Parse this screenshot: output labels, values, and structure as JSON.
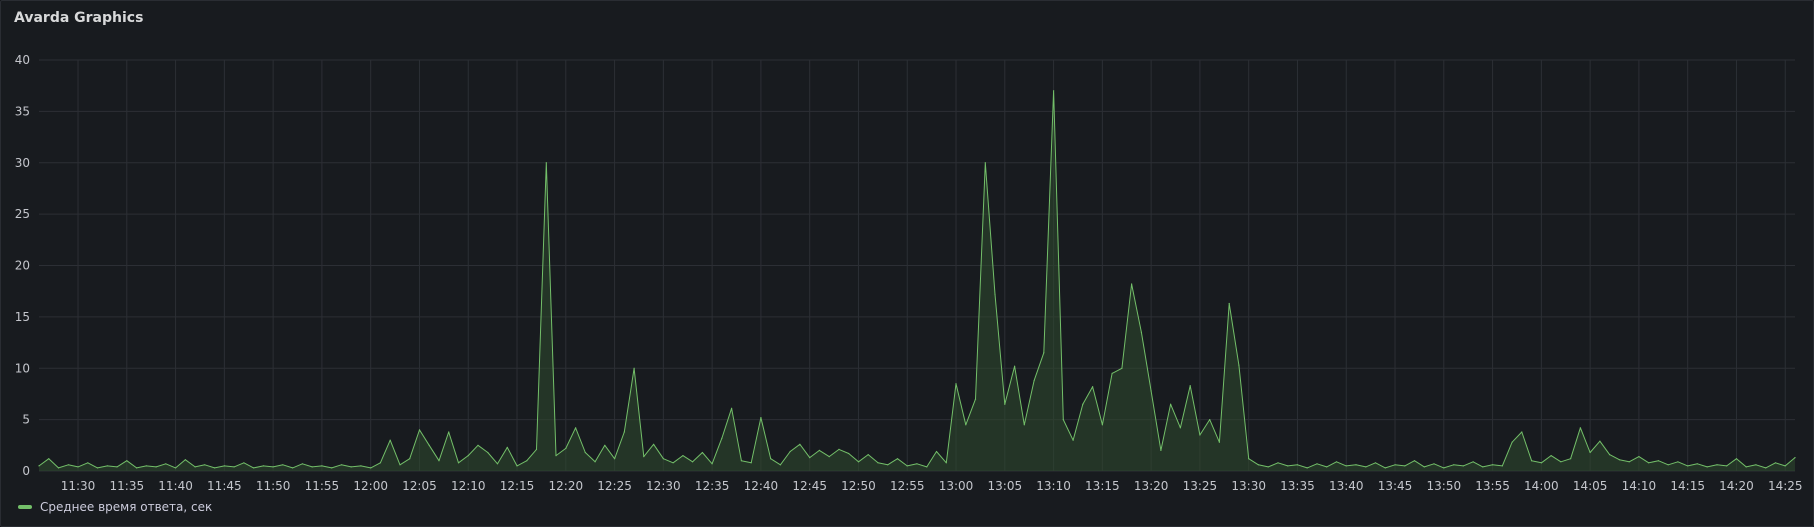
{
  "panel": {
    "title": "Avarda Graphics"
  },
  "colors": {
    "series": "#73bf69",
    "series_fill": "#2f4a2d",
    "grid": "#2c2f35",
    "background": "#181b1f"
  },
  "chart_data": {
    "type": "line",
    "title": "Avarda Graphics",
    "xlabel": "",
    "ylabel": "",
    "ylim": [
      0,
      40
    ],
    "y_ticks": [
      0,
      5,
      10,
      15,
      20,
      25,
      30,
      35,
      40
    ],
    "x_range": [
      "11:26",
      "14:26"
    ],
    "x_ticks": [
      "11:30",
      "11:35",
      "11:40",
      "11:45",
      "11:50",
      "11:55",
      "12:00",
      "12:05",
      "12:10",
      "12:15",
      "12:20",
      "12:25",
      "12:30",
      "12:35",
      "12:40",
      "12:45",
      "12:50",
      "12:55",
      "13:00",
      "13:05",
      "13:10",
      "13:15",
      "13:20",
      "13:25",
      "13:30",
      "13:35",
      "13:40",
      "13:45",
      "13:50",
      "13:55",
      "14:00",
      "14:05",
      "14:10",
      "14:15",
      "14:20",
      "14:25"
    ],
    "grid": true,
    "legend_placement": "bottom-left",
    "series": [
      {
        "name": "Среднее время ответа, сек",
        "color": "#73bf69",
        "points": [
          [
            "11:26",
            0.5
          ],
          [
            "11:27",
            1.2
          ],
          [
            "11:28",
            0.3
          ],
          [
            "11:29",
            0.6
          ],
          [
            "11:30",
            0.4
          ],
          [
            "11:31",
            0.8
          ],
          [
            "11:32",
            0.3
          ],
          [
            "11:33",
            0.5
          ],
          [
            "11:34",
            0.4
          ],
          [
            "11:35",
            1.0
          ],
          [
            "11:36",
            0.3
          ],
          [
            "11:37",
            0.5
          ],
          [
            "11:38",
            0.4
          ],
          [
            "11:39",
            0.7
          ],
          [
            "11:40",
            0.3
          ],
          [
            "11:41",
            1.1
          ],
          [
            "11:42",
            0.4
          ],
          [
            "11:43",
            0.6
          ],
          [
            "11:44",
            0.3
          ],
          [
            "11:45",
            0.5
          ],
          [
            "11:46",
            0.4
          ],
          [
            "11:47",
            0.8
          ],
          [
            "11:48",
            0.3
          ],
          [
            "11:49",
            0.5
          ],
          [
            "11:50",
            0.4
          ],
          [
            "11:51",
            0.6
          ],
          [
            "11:52",
            0.3
          ],
          [
            "11:53",
            0.7
          ],
          [
            "11:54",
            0.4
          ],
          [
            "11:55",
            0.5
          ],
          [
            "11:56",
            0.3
          ],
          [
            "11:57",
            0.6
          ],
          [
            "11:58",
            0.4
          ],
          [
            "11:59",
            0.5
          ],
          [
            "12:00",
            0.3
          ],
          [
            "12:01",
            0.8
          ],
          [
            "12:02",
            3.0
          ],
          [
            "12:03",
            0.6
          ],
          [
            "12:04",
            1.2
          ],
          [
            "12:05",
            4.0
          ],
          [
            "12:06",
            2.5
          ],
          [
            "12:07",
            1.0
          ],
          [
            "12:08",
            3.8
          ],
          [
            "12:09",
            0.8
          ],
          [
            "12:10",
            1.5
          ],
          [
            "12:11",
            2.5
          ],
          [
            "12:12",
            1.8
          ],
          [
            "12:13",
            0.7
          ],
          [
            "12:14",
            2.3
          ],
          [
            "12:15",
            0.5
          ],
          [
            "12:16",
            1.0
          ],
          [
            "12:17",
            2.1
          ],
          [
            "12:18",
            30.0
          ],
          [
            "12:19",
            1.5
          ],
          [
            "12:20",
            2.2
          ],
          [
            "12:21",
            4.2
          ],
          [
            "12:22",
            1.8
          ],
          [
            "12:23",
            0.9
          ],
          [
            "12:24",
            2.5
          ],
          [
            "12:25",
            1.2
          ],
          [
            "12:26",
            3.8
          ],
          [
            "12:27",
            10.0
          ],
          [
            "12:28",
            1.4
          ],
          [
            "12:29",
            2.6
          ],
          [
            "12:30",
            1.2
          ],
          [
            "12:31",
            0.8
          ],
          [
            "12:32",
            1.5
          ],
          [
            "12:33",
            0.9
          ],
          [
            "12:34",
            1.8
          ],
          [
            "12:35",
            0.7
          ],
          [
            "12:36",
            3.2
          ],
          [
            "12:37",
            6.1
          ],
          [
            "12:38",
            1.0
          ],
          [
            "12:39",
            0.8
          ],
          [
            "12:40",
            5.2
          ],
          [
            "12:41",
            1.2
          ],
          [
            "12:42",
            0.6
          ],
          [
            "12:43",
            1.9
          ],
          [
            "12:44",
            2.6
          ],
          [
            "12:45",
            1.3
          ],
          [
            "12:46",
            2.0
          ],
          [
            "12:47",
            1.4
          ],
          [
            "12:48",
            2.1
          ],
          [
            "12:49",
            1.7
          ],
          [
            "12:50",
            0.9
          ],
          [
            "12:51",
            1.6
          ],
          [
            "12:52",
            0.8
          ],
          [
            "12:53",
            0.6
          ],
          [
            "12:54",
            1.2
          ],
          [
            "12:55",
            0.5
          ],
          [
            "12:56",
            0.7
          ],
          [
            "12:57",
            0.4
          ],
          [
            "12:58",
            1.9
          ],
          [
            "12:59",
            0.8
          ],
          [
            "13:00",
            8.5
          ],
          [
            "13:01",
            4.5
          ],
          [
            "13:02",
            7.0
          ],
          [
            "13:03",
            30.0
          ],
          [
            "13:04",
            17.2
          ],
          [
            "13:05",
            6.5
          ],
          [
            "13:06",
            10.2
          ],
          [
            "13:07",
            4.5
          ],
          [
            "13:08",
            8.8
          ],
          [
            "13:09",
            11.5
          ],
          [
            "13:10",
            37.0
          ],
          [
            "13:11",
            5.0
          ],
          [
            "13:12",
            3.0
          ],
          [
            "13:13",
            6.5
          ],
          [
            "13:14",
            8.2
          ],
          [
            "13:15",
            4.5
          ],
          [
            "13:16",
            9.5
          ],
          [
            "13:17",
            10.0
          ],
          [
            "13:18",
            18.2
          ],
          [
            "13:19",
            13.5
          ],
          [
            "13:20",
            7.8
          ],
          [
            "13:21",
            2.0
          ],
          [
            "13:22",
            6.5
          ],
          [
            "13:23",
            4.2
          ],
          [
            "13:24",
            8.3
          ],
          [
            "13:25",
            3.5
          ],
          [
            "13:26",
            5.0
          ],
          [
            "13:27",
            2.8
          ],
          [
            "13:28",
            16.3
          ],
          [
            "13:29",
            10.3
          ],
          [
            "13:30",
            1.2
          ],
          [
            "13:31",
            0.6
          ],
          [
            "13:32",
            0.4
          ],
          [
            "13:33",
            0.8
          ],
          [
            "13:34",
            0.5
          ],
          [
            "13:35",
            0.6
          ],
          [
            "13:36",
            0.3
          ],
          [
            "13:37",
            0.7
          ],
          [
            "13:38",
            0.4
          ],
          [
            "13:39",
            0.9
          ],
          [
            "13:40",
            0.5
          ],
          [
            "13:41",
            0.6
          ],
          [
            "13:42",
            0.4
          ],
          [
            "13:43",
            0.8
          ],
          [
            "13:44",
            0.3
          ],
          [
            "13:45",
            0.6
          ],
          [
            "13:46",
            0.5
          ],
          [
            "13:47",
            1.0
          ],
          [
            "13:48",
            0.4
          ],
          [
            "13:49",
            0.7
          ],
          [
            "13:50",
            0.3
          ],
          [
            "13:51",
            0.6
          ],
          [
            "13:52",
            0.5
          ],
          [
            "13:53",
            0.9
          ],
          [
            "13:54",
            0.4
          ],
          [
            "13:55",
            0.6
          ],
          [
            "13:56",
            0.5
          ],
          [
            "13:57",
            2.8
          ],
          [
            "13:58",
            3.8
          ],
          [
            "13:59",
            1.0
          ],
          [
            "14:00",
            0.8
          ],
          [
            "14:01",
            1.5
          ],
          [
            "14:02",
            0.9
          ],
          [
            "14:03",
            1.2
          ],
          [
            "14:04",
            4.2
          ],
          [
            "14:05",
            1.8
          ],
          [
            "14:06",
            2.9
          ],
          [
            "14:07",
            1.6
          ],
          [
            "14:08",
            1.1
          ],
          [
            "14:09",
            0.9
          ],
          [
            "14:10",
            1.4
          ],
          [
            "14:11",
            0.8
          ],
          [
            "14:12",
            1.0
          ],
          [
            "14:13",
            0.6
          ],
          [
            "14:14",
            0.9
          ],
          [
            "14:15",
            0.5
          ],
          [
            "14:16",
            0.7
          ],
          [
            "14:17",
            0.4
          ],
          [
            "14:18",
            0.6
          ],
          [
            "14:19",
            0.5
          ],
          [
            "14:20",
            1.2
          ],
          [
            "14:21",
            0.4
          ],
          [
            "14:22",
            0.6
          ],
          [
            "14:23",
            0.3
          ],
          [
            "14:24",
            0.8
          ],
          [
            "14:25",
            0.5
          ],
          [
            "14:26",
            1.3
          ]
        ]
      }
    ]
  },
  "legend": {
    "items": [
      {
        "label": "Среднее время ответа, сек",
        "color": "#73bf69"
      }
    ]
  }
}
